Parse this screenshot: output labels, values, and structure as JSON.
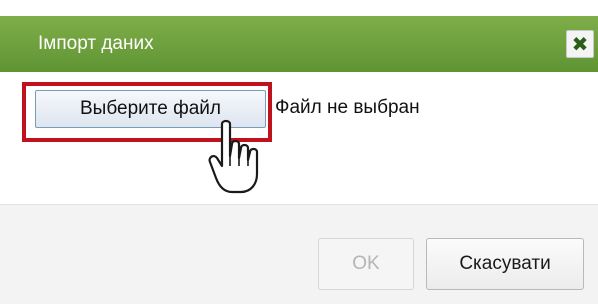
{
  "dialog": {
    "title": "Імпорт даних",
    "close_icon": "close-icon",
    "close_glyph": "✖"
  },
  "file_input": {
    "button_label": "Выберите файл",
    "status_text": "Файл не выбран"
  },
  "footer": {
    "ok_label": "OK",
    "cancel_label": "Скасувати"
  },
  "colors": {
    "titlebar": "#6a9e3b",
    "highlight": "#c0121e"
  },
  "icons": {
    "pointer": "hand-pointer-icon"
  }
}
